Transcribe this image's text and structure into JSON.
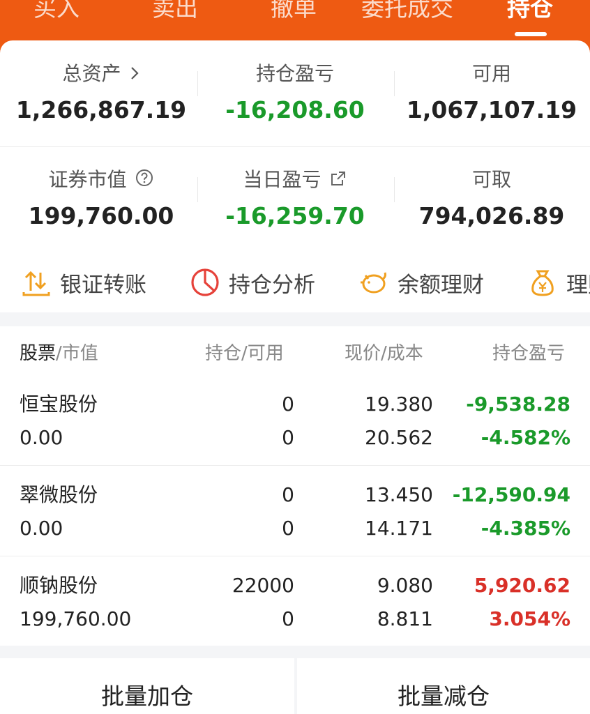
{
  "tabs": [
    {
      "label": "买入"
    },
    {
      "label": "卖出"
    },
    {
      "label": "撤单"
    },
    {
      "label": "委托成交"
    },
    {
      "label": "持仓"
    }
  ],
  "summary": {
    "total_assets_label": "总资产",
    "total_assets_value": "1,266,867.19",
    "position_pl_label": "持仓盈亏",
    "position_pl_value": "-16,208.60",
    "available_label": "可用",
    "available_value": "1,067,107.19",
    "market_value_label": "证券市值",
    "market_value_value": "199,760.00",
    "daily_pl_label": "当日盈亏",
    "daily_pl_value": "-16,259.70",
    "withdrawable_label": "可取",
    "withdrawable_value": "794,026.89"
  },
  "shortcuts": [
    {
      "label": "银证转账",
      "icon": "transfer-icon"
    },
    {
      "label": "持仓分析",
      "icon": "pie-chart-icon"
    },
    {
      "label": "余额理财",
      "icon": "piggy-bank-icon"
    },
    {
      "label": "理财",
      "icon": "money-bag-icon"
    }
  ],
  "table": {
    "headers": {
      "stock": "股票",
      "market_value": "/市值",
      "position_available": "持仓/可用",
      "price_cost": "现价/成本",
      "pl": "持仓盈亏"
    },
    "rows": [
      {
        "name": "恒宝股份",
        "market_value": "0.00",
        "position": "0",
        "available": "0",
        "price": "19.380",
        "cost": "20.562",
        "pl": "-9,538.28",
        "pl_pct": "-4.582%",
        "status": "loss"
      },
      {
        "name": "翠微股份",
        "market_value": "0.00",
        "position": "0",
        "available": "0",
        "price": "13.450",
        "cost": "14.171",
        "pl": "-12,590.94",
        "pl_pct": "-4.385%",
        "status": "loss"
      },
      {
        "name": "顺钠股份",
        "market_value": "199,760.00",
        "position": "22000",
        "available": "0",
        "price": "9.080",
        "cost": "8.811",
        "pl": "5,920.62",
        "pl_pct": "3.054%",
        "status": "gain"
      }
    ]
  },
  "actions": {
    "batch_add": "批量加仓",
    "batch_reduce": "批量减仓"
  },
  "colors": {
    "brand": "#ee5a12",
    "loss": "#1a9a2a",
    "gain": "#d93028"
  }
}
